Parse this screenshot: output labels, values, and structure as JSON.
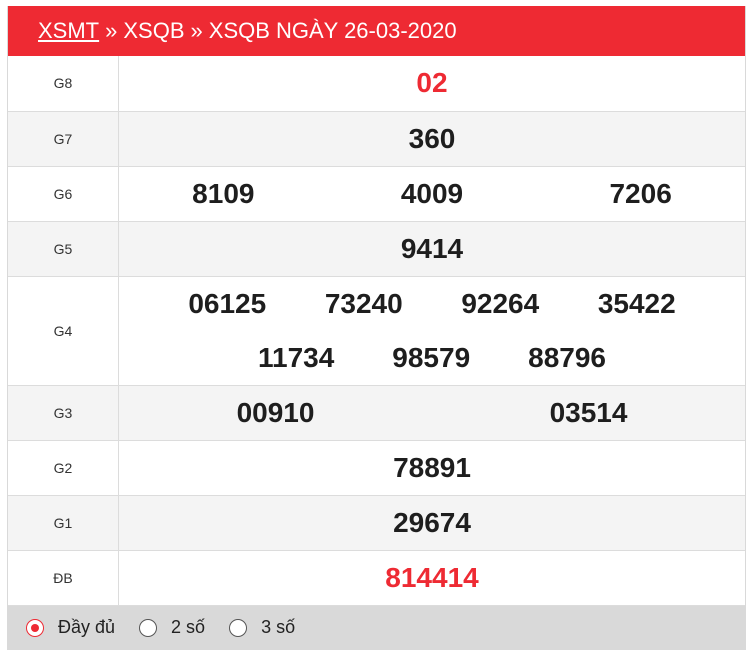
{
  "header": {
    "link": "XSMT",
    "sep": "»",
    "crumb2": "XSQB",
    "crumb3": "XSQB NGÀY 26-03-2020"
  },
  "prizes": [
    {
      "label": "G8",
      "numbers": [
        "02"
      ]
    },
    {
      "label": "G7",
      "numbers": [
        "360"
      ]
    },
    {
      "label": "G6",
      "numbers": [
        "8109",
        "4009",
        "7206"
      ]
    },
    {
      "label": "G5",
      "numbers": [
        "9414"
      ]
    },
    {
      "label": "G4",
      "numbers": [
        "06125",
        "73240",
        "92264",
        "35422",
        "11734",
        "98579",
        "88796"
      ]
    },
    {
      "label": "G3",
      "numbers": [
        "00910",
        "03514"
      ]
    },
    {
      "label": "G2",
      "numbers": [
        "78891"
      ]
    },
    {
      "label": "G1",
      "numbers": [
        "29674"
      ]
    },
    {
      "label": "ĐB",
      "numbers": [
        "814414"
      ]
    }
  ],
  "footer": {
    "options": [
      "Đầy đủ",
      "2 số",
      "3 số"
    ],
    "selected": "Đầy đủ"
  },
  "colors": {
    "accent": "#ee2a33"
  }
}
